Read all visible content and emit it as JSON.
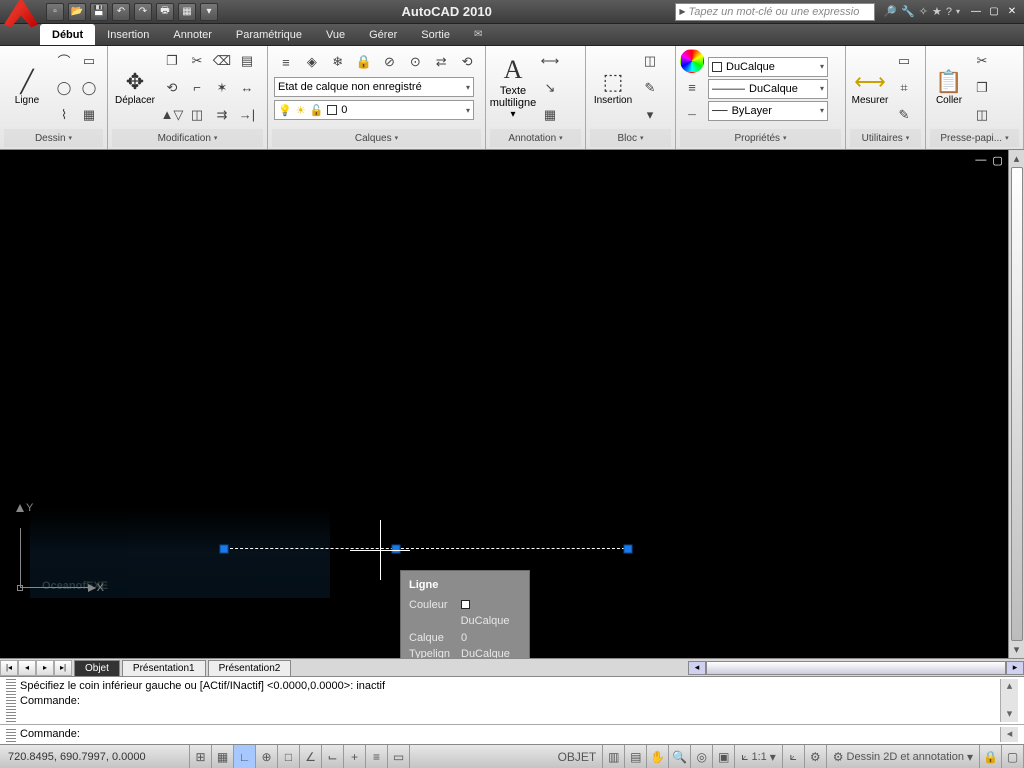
{
  "app": {
    "title": "AutoCAD 2010",
    "search_placeholder": "Tapez un mot-clé ou une expressio"
  },
  "menu": {
    "tabs": [
      "Début",
      "Insertion",
      "Annoter",
      "Paramétrique",
      "Vue",
      "Gérer",
      "Sortie"
    ],
    "active": "Début"
  },
  "ribbon": {
    "dessin": {
      "label": "Dessin",
      "ligne": "Ligne"
    },
    "modification": {
      "label": "Modification",
      "deplacer": "Déplacer"
    },
    "calques": {
      "label": "Calques",
      "state": "Etat de calque non enregistré",
      "layer_num": "0"
    },
    "annotation": {
      "label": "Annotation",
      "texte": "Texte\nmultiligne"
    },
    "bloc": {
      "label": "Bloc",
      "insertion": "Insertion"
    },
    "proprietes": {
      "label": "Propriétés",
      "color": "DuCalque",
      "ltype": "DuCalque",
      "lweight": "ByLayer"
    },
    "utilitaires": {
      "label": "Utilitaires",
      "mesurer": "Mesurer"
    },
    "presse": {
      "label": "Presse-papi...",
      "coller": "Coller"
    }
  },
  "tooltip": {
    "title": "Ligne",
    "rows": [
      {
        "k": "Couleur",
        "v": "DuCalque",
        "swatch": true
      },
      {
        "k": "Calque",
        "v": "0"
      },
      {
        "k": "Typelign",
        "v": "DuCalque"
      }
    ]
  },
  "ucs": {
    "x": "X",
    "y": "Y"
  },
  "watermark": "OceanofEXE",
  "layout_tabs": [
    "Objet",
    "Présentation1",
    "Présentation2"
  ],
  "cmd": {
    "line1": "Spécifiez le coin inférieur gauche ou [ACtif/INactif] <0.0000,0.0000>: inactif",
    "line2": "Commande:",
    "line3": "Commande:"
  },
  "status": {
    "coords": "720.8495, 690.7997, 0.0000",
    "objet": "OBJET",
    "scale": "1:1",
    "ws": "Dessin 2D et annotation"
  }
}
